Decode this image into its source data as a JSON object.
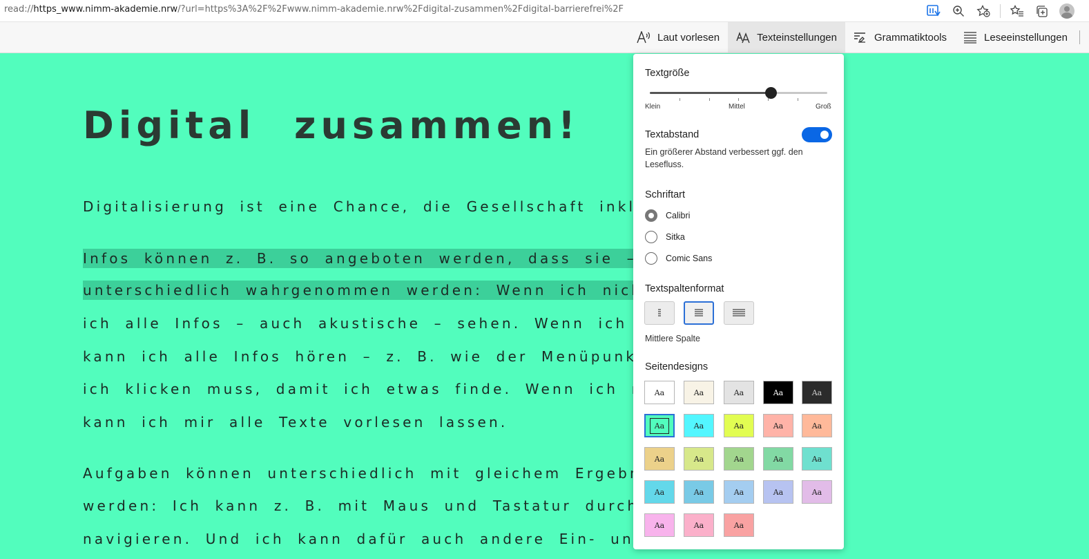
{
  "browser": {
    "url_prefix": "read://",
    "url_host": "https_www.nimm-akademie.nrw",
    "url_rest": "/?url=https%3A%2F%2Fwww.nimm-akademie.nrw%2Fdigital-zusammen%2Fdigital-barrierefrei%2F"
  },
  "toolbar": {
    "read_aloud": "Laut vorlesen",
    "text_settings": "Texteinstellungen",
    "grammar_tools": "Grammatiktools",
    "reading_settings": "Leseeinstellungen"
  },
  "article": {
    "title": "Digital zusammen!",
    "lines": [
      "Digitalisierung ist eine Chance, die Gesellschaft inklusiv",
      "Infos können z. B. so angeboten werden, dass sie – e",
      "unterschiedlich wahrgenommen werden: Wenn ich nicht",
      "ich alle Infos – auch akustische – sehen. Wenn ich n",
      "kann ich alle Infos hören – z. B. wie der Menüpunkt",
      "ich klicken muss, damit ich etwas finde. Wenn ich nic",
      "kann ich mir alle Texte vorlesen lassen.",
      "Aufgaben können unterschiedlich mit gleichem Ergebnis",
      "werden: Ich kann z. B. mit Maus und Tastatur durch",
      "navigieren. Und ich kann dafür auch andere Ein- und"
    ]
  },
  "panel": {
    "text_size": {
      "heading": "Textgröße",
      "label_small": "Klein",
      "label_medium": "Mittel",
      "label_large": "Groß",
      "level": 0.68
    },
    "text_spacing": {
      "heading": "Textabstand",
      "description": "Ein größerer Abstand verbessert ggf. den Lesefluss.",
      "enabled": true
    },
    "font": {
      "heading": "Schriftart",
      "options": [
        "Calibri",
        "Sitka",
        "Comic Sans"
      ],
      "selected": "Calibri"
    },
    "column_format": {
      "heading": "Textspaltenformat",
      "selected_caption": "Mittlere Spalte"
    },
    "page_themes": {
      "heading": "Seitendesigns",
      "swatch_label": "Aa",
      "swatches": [
        {
          "bg": "#ffffff",
          "fg": "#222222"
        },
        {
          "bg": "#f8f3e6",
          "fg": "#222222"
        },
        {
          "bg": "#e3e3e3",
          "fg": "#222222"
        },
        {
          "bg": "#000000",
          "fg": "#ffffff"
        },
        {
          "bg": "#2b2b2b",
          "fg": "#cccccc"
        },
        {
          "bg": "#52fdbd",
          "fg": "#222222"
        },
        {
          "bg": "#53f6ff",
          "fg": "#222222"
        },
        {
          "bg": "#e2fd52",
          "fg": "#222222"
        },
        {
          "bg": "#ffb3a8",
          "fg": "#222222"
        },
        {
          "bg": "#ffb99a",
          "fg": "#222222"
        },
        {
          "bg": "#ecd18a",
          "fg": "#222222"
        },
        {
          "bg": "#d7e88a",
          "fg": "#222222"
        },
        {
          "bg": "#a2d68e",
          "fg": "#222222"
        },
        {
          "bg": "#82d9a4",
          "fg": "#222222"
        },
        {
          "bg": "#6fe0cf",
          "fg": "#222222"
        },
        {
          "bg": "#63d8ea",
          "fg": "#222222"
        },
        {
          "bg": "#79cae6",
          "fg": "#222222"
        },
        {
          "bg": "#a4cdf0",
          "fg": "#222222"
        },
        {
          "bg": "#b7c3f1",
          "fg": "#222222"
        },
        {
          "bg": "#e2bce8",
          "fg": "#222222"
        },
        {
          "bg": "#f8b3ec",
          "fg": "#222222"
        },
        {
          "bg": "#fbb0ca",
          "fg": "#222222"
        },
        {
          "bg": "#f9a2a2",
          "fg": "#222222"
        }
      ],
      "selected_index": 5
    }
  },
  "colors": {
    "page_background": "#52fdbd",
    "highlight": "#3cd09a",
    "accent": "#0a67e5"
  }
}
